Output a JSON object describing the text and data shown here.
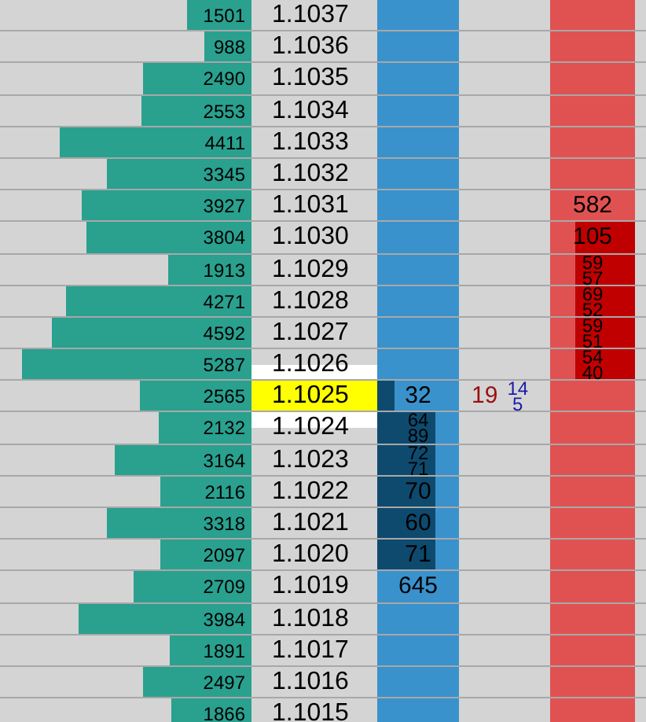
{
  "rows": [
    {
      "volume": "1501",
      "price": "1.1037"
    },
    {
      "volume": "988",
      "price": "1.1036"
    },
    {
      "volume": "2490",
      "price": "1.1035"
    },
    {
      "volume": "2553",
      "price": "1.1034"
    },
    {
      "volume": "4411",
      "price": "1.1033"
    },
    {
      "volume": "3345",
      "price": "1.1032"
    },
    {
      "volume": "3927",
      "price": "1.1031",
      "ask": {
        "texts": [
          "582"
        ]
      }
    },
    {
      "volume": "3804",
      "price": "1.1030",
      "ask": {
        "texts": [
          "105"
        ],
        "level": 0.7
      }
    },
    {
      "volume": "1913",
      "price": "1.1029",
      "ask": {
        "texts": [
          "59",
          "57"
        ],
        "level": 0.7
      }
    },
    {
      "volume": "4271",
      "price": "1.1028",
      "ask": {
        "texts": [
          "69",
          "52"
        ],
        "level": 0.7
      }
    },
    {
      "volume": "4592",
      "price": "1.1027",
      "ask": {
        "texts": [
          "59",
          "51"
        ],
        "level": 0.7
      }
    },
    {
      "volume": "5287",
      "price": "1.1026",
      "best_ask": true,
      "ask": {
        "texts": [
          "54",
          "40"
        ],
        "level": 0.7
      }
    },
    {
      "volume": "2565",
      "price": "1.1025",
      "last_price": true,
      "bid": {
        "texts": [
          "32"
        ],
        "level": 0.22
      },
      "sells": [
        "19"
      ],
      "buys": [
        "14",
        "5"
      ]
    },
    {
      "volume": "2132",
      "price": "1.1024",
      "best_bid": true,
      "bid": {
        "texts": [
          "64",
          "89"
        ],
        "level": 0.72
      }
    },
    {
      "volume": "3164",
      "price": "1.1023",
      "bid": {
        "texts": [
          "72",
          "71"
        ],
        "level": 0.72
      }
    },
    {
      "volume": "2116",
      "price": "1.1022",
      "bid": {
        "texts": [
          "70"
        ],
        "level": 0.72
      }
    },
    {
      "volume": "3318",
      "price": "1.1021",
      "bid": {
        "texts": [
          "60"
        ],
        "level": 0.72
      }
    },
    {
      "volume": "2097",
      "price": "1.1020",
      "bid": {
        "texts": [
          "71"
        ],
        "level": 0.72
      }
    },
    {
      "volume": "2709",
      "price": "1.1019",
      "bid": {
        "texts": [
          "645"
        ]
      }
    },
    {
      "volume": "3984",
      "price": "1.1018"
    },
    {
      "volume": "1891",
      "price": "1.1017"
    },
    {
      "volume": "2497",
      "price": "1.1016"
    },
    {
      "volume": "1866",
      "price": "1.1015"
    }
  ]
}
